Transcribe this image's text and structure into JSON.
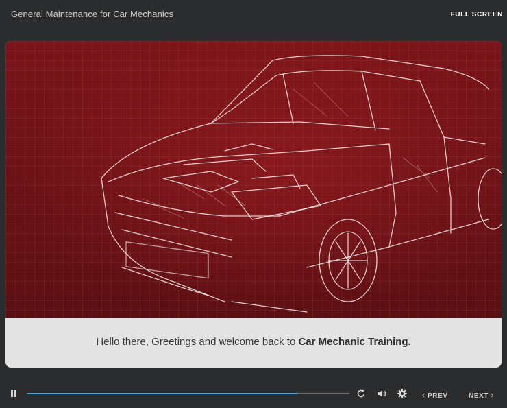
{
  "header": {
    "course_title": "General Maintenance for Car Mechanics",
    "fullscreen_label": "FULL SCREEN"
  },
  "slide": {
    "image_subject": "car wireframe blueprint",
    "caption_prefix": "Hello there, Greetings and welcome back to ",
    "caption_emphasis": "Car Mechanic Training."
  },
  "controls": {
    "progress_fraction": 0.84,
    "prev_label": "PREV",
    "next_label": "NEXT",
    "icons": [
      "pause-icon",
      "replay-icon",
      "volume-icon",
      "settings-icon",
      "chevron-left-icon",
      "chevron-right-icon"
    ]
  },
  "colors": {
    "background": "#2b2c2d",
    "accent_progress": "#4aa3df",
    "hero_red": "#6b1216",
    "caption_bg": "#e4e4e4"
  }
}
